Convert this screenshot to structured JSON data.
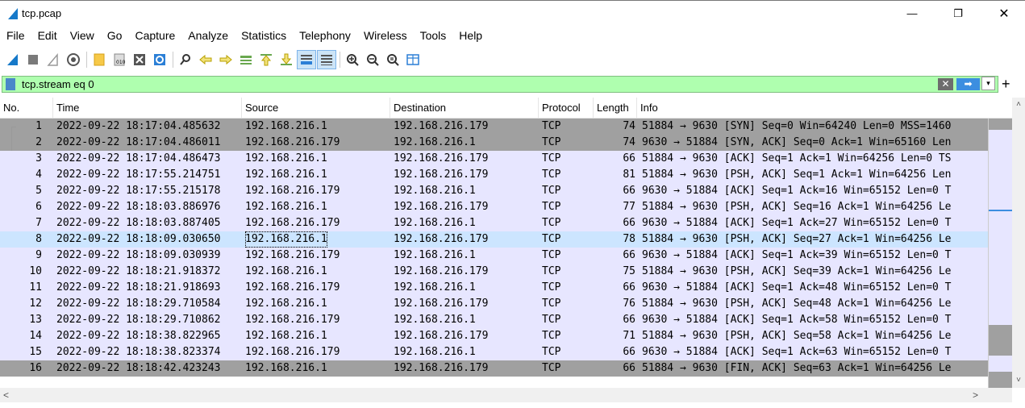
{
  "window": {
    "title": "tcp.pcap",
    "minimize_glyph": "—",
    "maximize_glyph": "❐",
    "close_glyph": "✕"
  },
  "menu": [
    "File",
    "Edit",
    "View",
    "Go",
    "Capture",
    "Analyze",
    "Statistics",
    "Telephony",
    "Wireless",
    "Tools",
    "Help"
  ],
  "toolbar": {
    "icons": [
      "shark-fin-start-icon",
      "stop-capture-icon",
      "restart-capture-icon",
      "capture-options-icon",
      "open-file-icon",
      "save-file-icon",
      "close-file-icon",
      "reload-file-icon",
      "find-packet-icon",
      "go-back-icon",
      "go-forward-icon",
      "go-to-packet-icon",
      "go-first-icon",
      "go-last-icon",
      "auto-scroll-icon",
      "colorize-icon",
      "zoom-in-icon",
      "zoom-out-icon",
      "zoom-reset-icon",
      "resize-columns-icon"
    ]
  },
  "filter": {
    "value": "tcp.stream eq 0",
    "clear_glyph": "✕",
    "apply_glyph": "➡",
    "dropdown_glyph": "▾",
    "add_glyph": "+",
    "bg_color": "#afffaf"
  },
  "columns": [
    "No.",
    "Time",
    "Source",
    "Destination",
    "Protocol",
    "Length",
    "Info"
  ],
  "colors": {
    "syn_fin_row": "#a0a0a0",
    "tcp_row": "#e7e6ff",
    "selected_row": "#cce5ff"
  },
  "packets": [
    {
      "no": "1",
      "time": "2022-09-22 18:17:04.485632",
      "src": "192.168.216.1",
      "dst": "192.168.216.179",
      "proto": "TCP",
      "len": "74",
      "info": "51884 → 9630 [SYN] Seq=0 Win=64240 Len=0 MSS=1460"
    },
    {
      "no": "2",
      "time": "2022-09-22 18:17:04.486011",
      "src": "192.168.216.179",
      "dst": "192.168.216.1",
      "proto": "TCP",
      "len": "74",
      "info": "9630 → 51884 [SYN, ACK] Seq=0 Ack=1 Win=65160 Len"
    },
    {
      "no": "3",
      "time": "2022-09-22 18:17:04.486473",
      "src": "192.168.216.1",
      "dst": "192.168.216.179",
      "proto": "TCP",
      "len": "66",
      "info": "51884 → 9630 [ACK] Seq=1 Ack=1 Win=64256 Len=0 TS"
    },
    {
      "no": "4",
      "time": "2022-09-22 18:17:55.214751",
      "src": "192.168.216.1",
      "dst": "192.168.216.179",
      "proto": "TCP",
      "len": "81",
      "info": "51884 → 9630 [PSH, ACK] Seq=1 Ack=1 Win=64256 Len"
    },
    {
      "no": "5",
      "time": "2022-09-22 18:17:55.215178",
      "src": "192.168.216.179",
      "dst": "192.168.216.1",
      "proto": "TCP",
      "len": "66",
      "info": "9630 → 51884 [ACK] Seq=1 Ack=16 Win=65152 Len=0 T"
    },
    {
      "no": "6",
      "time": "2022-09-22 18:18:03.886976",
      "src": "192.168.216.1",
      "dst": "192.168.216.179",
      "proto": "TCP",
      "len": "77",
      "info": "51884 → 9630 [PSH, ACK] Seq=16 Ack=1 Win=64256 Le"
    },
    {
      "no": "7",
      "time": "2022-09-22 18:18:03.887405",
      "src": "192.168.216.179",
      "dst": "192.168.216.1",
      "proto": "TCP",
      "len": "66",
      "info": "9630 → 51884 [ACK] Seq=1 Ack=27 Win=65152 Len=0 T"
    },
    {
      "no": "8",
      "time": "2022-09-22 18:18:09.030650",
      "src": "192.168.216.1",
      "dst": "192.168.216.179",
      "proto": "TCP",
      "len": "78",
      "info": "51884 → 9630 [PSH, ACK] Seq=27 Ack=1 Win=64256 Le",
      "selected": true
    },
    {
      "no": "9",
      "time": "2022-09-22 18:18:09.030939",
      "src": "192.168.216.179",
      "dst": "192.168.216.1",
      "proto": "TCP",
      "len": "66",
      "info": "9630 → 51884 [ACK] Seq=1 Ack=39 Win=65152 Len=0 T"
    },
    {
      "no": "10",
      "time": "2022-09-22 18:18:21.918372",
      "src": "192.168.216.1",
      "dst": "192.168.216.179",
      "proto": "TCP",
      "len": "75",
      "info": "51884 → 9630 [PSH, ACK] Seq=39 Ack=1 Win=64256 Le"
    },
    {
      "no": "11",
      "time": "2022-09-22 18:18:21.918693",
      "src": "192.168.216.179",
      "dst": "192.168.216.1",
      "proto": "TCP",
      "len": "66",
      "info": "9630 → 51884 [ACK] Seq=1 Ack=48 Win=65152 Len=0 T"
    },
    {
      "no": "12",
      "time": "2022-09-22 18:18:29.710584",
      "src": "192.168.216.1",
      "dst": "192.168.216.179",
      "proto": "TCP",
      "len": "76",
      "info": "51884 → 9630 [PSH, ACK] Seq=48 Ack=1 Win=64256 Le"
    },
    {
      "no": "13",
      "time": "2022-09-22 18:18:29.710862",
      "src": "192.168.216.179",
      "dst": "192.168.216.1",
      "proto": "TCP",
      "len": "66",
      "info": "9630 → 51884 [ACK] Seq=1 Ack=58 Win=65152 Len=0 T"
    },
    {
      "no": "14",
      "time": "2022-09-22 18:18:38.822965",
      "src": "192.168.216.1",
      "dst": "192.168.216.179",
      "proto": "TCP",
      "len": "71",
      "info": "51884 → 9630 [PSH, ACK] Seq=58 Ack=1 Win=64256 Le"
    },
    {
      "no": "15",
      "time": "2022-09-22 18:18:38.823374",
      "src": "192.168.216.179",
      "dst": "192.168.216.1",
      "proto": "TCP",
      "len": "66",
      "info": "9630 → 51884 [ACK] Seq=1 Ack=63 Win=65152 Len=0 T"
    },
    {
      "no": "16",
      "time": "2022-09-22 18:18:42.423243",
      "src": "192.168.216.1",
      "dst": "192.168.216.179",
      "proto": "TCP",
      "len": "66",
      "info": "51884 → 9630 [FIN, ACK] Seq=63 Ack=1 Win=64256 Le"
    }
  ],
  "scroll": {
    "up_glyph": "˄",
    "down_glyph": "˅",
    "left_glyph": "<",
    "right_glyph": ">"
  }
}
